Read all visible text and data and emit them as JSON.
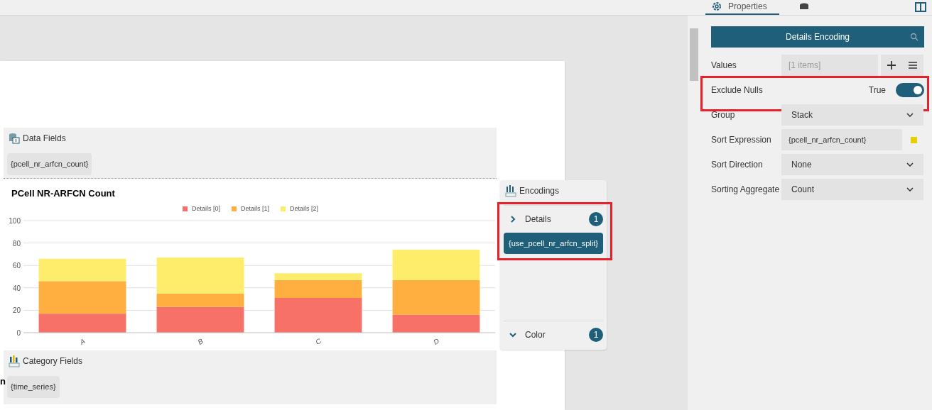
{
  "top_tabs": [
    {
      "kind": "properties",
      "label": "Properties",
      "selected": true
    },
    {
      "kind": "data",
      "selected": false
    }
  ],
  "data_fields": {
    "title": "Data Fields",
    "items": [
      "{pcell_nr_arfcn_count}"
    ]
  },
  "chart": {
    "title": "PCell NR-ARFCN Count",
    "chart_data": {
      "type": "bar",
      "stacked": true,
      "grid": true,
      "categories": [
        "A",
        "B",
        "C",
        "D"
      ],
      "ylim": [
        0,
        100
      ],
      "yticks": [
        0,
        20,
        40,
        60,
        80,
        100
      ],
      "series": [
        {
          "name": "Details [0]",
          "color": "#f87168",
          "values": [
            17,
            23,
            31,
            16
          ]
        },
        {
          "name": "Details [1]",
          "color": "#ffae40",
          "values": [
            29,
            12,
            16,
            31
          ]
        },
        {
          "name": "Details [2]",
          "color": "#feec6b",
          "values": [
            20,
            32,
            6,
            27
          ]
        }
      ]
    }
  },
  "category_fields": {
    "title": "Category Fields",
    "items": [
      "{time_series}"
    ]
  },
  "cut_text": "n",
  "encodings": {
    "title": "Encodings",
    "groups": [
      {
        "label": "Details",
        "count": "1",
        "expanded": false,
        "items": [
          "{use_pcell_nr_arfcn_split}"
        ],
        "highlighted": true
      },
      {
        "label": "Color",
        "count": "1",
        "expanded": true,
        "highlighted": false
      }
    ]
  },
  "properties": {
    "header": "Details Encoding",
    "rows": [
      {
        "kind": "list",
        "label": "Values",
        "value": "[1 items]",
        "highlighted": false
      },
      {
        "kind": "toggle",
        "label": "Exclude Nulls",
        "value": "True",
        "on": true,
        "highlighted": true
      },
      {
        "kind": "select",
        "label": "Group",
        "value": "Stack",
        "highlighted": false
      },
      {
        "kind": "expression",
        "label": "Sort Expression",
        "value": "{pcell_nr_arfcn_count}",
        "color": "#e5d000",
        "highlighted": false
      },
      {
        "kind": "select",
        "label": "Sort Direction",
        "value": "None",
        "highlighted": false
      },
      {
        "kind": "select",
        "label": "Sorting Aggregate",
        "value": "Count",
        "highlighted": false
      }
    ]
  }
}
